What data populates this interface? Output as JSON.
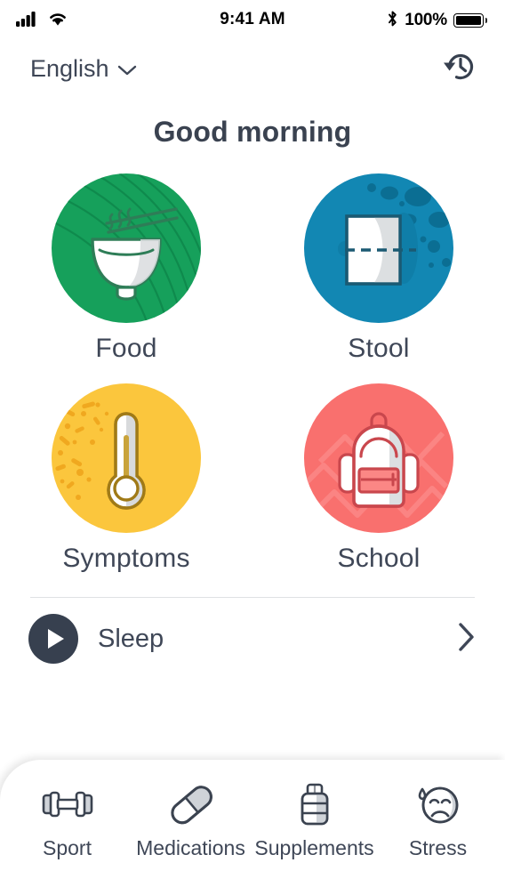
{
  "status_bar": {
    "signal_icon": "cellular-signal-icon",
    "wifi_icon": "wifi-icon",
    "time": "9:41 AM",
    "bluetooth_icon": "bluetooth-icon",
    "battery_percent": "100%",
    "battery_icon": "battery-full-icon"
  },
  "header": {
    "language": "English",
    "language_chevron_icon": "chevron-down-icon",
    "history_icon": "history-clock-icon"
  },
  "greeting": "Good morning",
  "tiles": [
    {
      "label": "Food",
      "icon": "noodle-bowl-icon",
      "color": "#16a05b",
      "pattern": "swirl-lines"
    },
    {
      "label": "Stool",
      "icon": "toilet-paper-icon",
      "color": "#1287b3",
      "pattern": "bubbles"
    },
    {
      "label": "Symptoms",
      "icon": "thermometer-icon",
      "color": "#fbc63d",
      "pattern": "speckles"
    },
    {
      "label": "School",
      "icon": "backpack-icon",
      "color": "#f9706e",
      "pattern": "zigzag"
    }
  ],
  "sleep_row": {
    "play_icon": "play-icon",
    "label": "Sleep",
    "chevron_icon": "chevron-right-icon"
  },
  "bottom_nav": [
    {
      "label": "Sport",
      "icon": "dumbbell-icon"
    },
    {
      "label": "Medications",
      "icon": "pill-capsule-icon"
    },
    {
      "label": "Supplements",
      "icon": "supplement-bottle-icon"
    },
    {
      "label": "Stress",
      "icon": "stressed-face-icon"
    }
  ],
  "colors": {
    "text_dark": "#3f4757",
    "title": "#3a4250",
    "divider": "#dfe1e4",
    "play_button": "#37404f",
    "food_green": "#16a05b",
    "stool_blue": "#1287b3",
    "symptoms_yellow": "#fbc63d",
    "school_coral": "#f9706e"
  }
}
